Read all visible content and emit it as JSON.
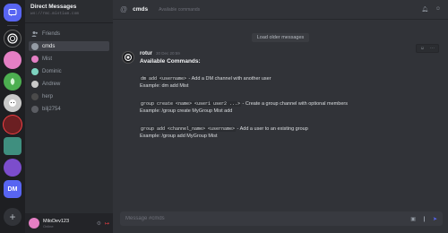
{
  "servers": [
    {
      "name": "home",
      "label": ""
    },
    {
      "name": "server-1",
      "label": "",
      "color": "#3a3c41"
    },
    {
      "name": "server-2",
      "label": "",
      "color": "#e47fc4"
    },
    {
      "name": "server-3",
      "label": "",
      "color": "#4caf50"
    },
    {
      "name": "server-4",
      "label": "",
      "color": "#c9c9c9"
    },
    {
      "name": "server-5",
      "label": "",
      "color": "#6b1f22"
    },
    {
      "name": "server-6",
      "label": "",
      "color": "#3f8f7f"
    },
    {
      "name": "server-7",
      "label": "",
      "color": "#7c4dcc"
    },
    {
      "name": "server-dm",
      "label": "DM",
      "color": "#5865f2"
    }
  ],
  "sidebar": {
    "title": "Direct Messages",
    "subtitle": "ws://rmc.mistium.com",
    "items": [
      {
        "label": "Friends",
        "type": "friends"
      },
      {
        "label": "cmds",
        "color": "#949ba4",
        "active": true
      },
      {
        "label": "Mist",
        "color": "#e47fc4"
      },
      {
        "label": "Dominic",
        "color": "#7dd3c0"
      },
      {
        "label": "Andrew",
        "color": "#c9c9c9"
      },
      {
        "label": "herp",
        "color": "#4a4a4a"
      },
      {
        "label": "bilj2754",
        "color": "#5b5d63"
      }
    ]
  },
  "user": {
    "name": "MiloDev123",
    "status": "Online"
  },
  "channel": {
    "name": "cmds",
    "description": "Available commands"
  },
  "load_older": "Load older messages",
  "message": {
    "author": "rotur",
    "time": "30 Dec 20:59",
    "title": "Available Commands:",
    "commands": [
      {
        "code": "dm add <username>",
        "desc": " - Add a DM channel with another user",
        "example": "Example: dm add Mist"
      },
      {
        "code": "group create <name> <user1 user2 ...>",
        "desc": " - Create a group channel with optional members",
        "example": "Example: /group create MyGroup Mist add"
      },
      {
        "code": "group add <channel_name> <username>",
        "desc": " - Add a user to an existing group",
        "example": "Example: /group add MyGroup Mist"
      }
    ]
  },
  "composer": {
    "placeholder": "Message #cmds"
  }
}
